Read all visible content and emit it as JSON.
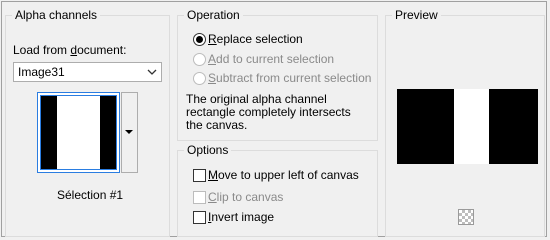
{
  "alpha_channels": {
    "title": "Alpha channels",
    "load_label": "Load from document:",
    "document_value": "Image31",
    "selection_label": "Sélection #1"
  },
  "operation": {
    "title": "Operation",
    "replace": "Replace selection",
    "add": "Add to current selection",
    "subtract": "Subtract from current selection",
    "selected": "replace",
    "message": "The original alpha channel rectangle completely intersects the canvas."
  },
  "options": {
    "title": "Options",
    "move": "Move to upper left of canvas",
    "clip": "Clip to canvas",
    "invert": "Invert image",
    "move_checked": false,
    "clip_checked": false,
    "invert_checked": false
  },
  "preview": {
    "title": "Preview"
  },
  "icons": {
    "dropdown": "chevron-down-icon",
    "transparency": "transparency-checker-icon"
  }
}
